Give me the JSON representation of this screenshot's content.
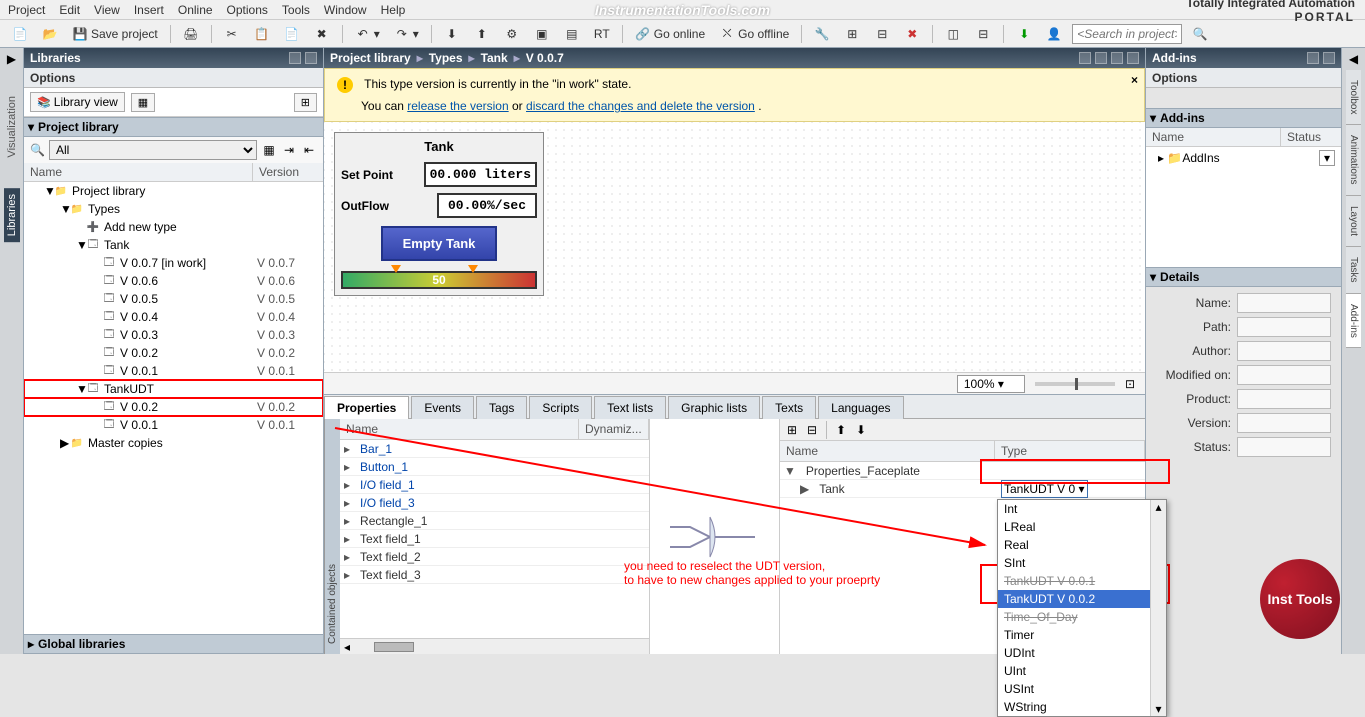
{
  "menubar": [
    "Project",
    "Edit",
    "View",
    "Insert",
    "Online",
    "Options",
    "Tools",
    "Window",
    "Help"
  ],
  "ad_text": "InstrumentationTools.com",
  "portal_title": "Totally Integrated Automation",
  "portal_sub": "PORTAL",
  "toolbar": {
    "save_label": "Save project",
    "go_online": "Go online",
    "go_offline": "Go offline",
    "search_placeholder": "<Search in project>"
  },
  "left": {
    "panel_title": "Libraries",
    "options_label": "Options",
    "library_view_btn": "Library view",
    "section1": "Project library",
    "filter_all": "All",
    "cols": {
      "name": "Name",
      "version": "Version"
    },
    "tree": [
      {
        "indent": 1,
        "caret": "▼",
        "ico": "📁",
        "label": "Project library",
        "ver": ""
      },
      {
        "indent": 2,
        "caret": "▼",
        "ico": "📁",
        "label": "Types",
        "ver": ""
      },
      {
        "indent": 3,
        "caret": "",
        "ico": "➕",
        "label": "Add new type",
        "ver": ""
      },
      {
        "indent": 3,
        "caret": "▼",
        "ico": "🗔",
        "label": "Tank",
        "ver": ""
      },
      {
        "indent": 4,
        "caret": "",
        "ico": "🗔",
        "label": "V 0.0.7 [in work]",
        "ver": "V 0.0.7"
      },
      {
        "indent": 4,
        "caret": "",
        "ico": "🗔",
        "label": "V 0.0.6",
        "ver": "V 0.0.6"
      },
      {
        "indent": 4,
        "caret": "",
        "ico": "🗔",
        "label": "V 0.0.5",
        "ver": "V 0.0.5"
      },
      {
        "indent": 4,
        "caret": "",
        "ico": "🗔",
        "label": "V 0.0.4",
        "ver": "V 0.0.4"
      },
      {
        "indent": 4,
        "caret": "",
        "ico": "🗔",
        "label": "V 0.0.3",
        "ver": "V 0.0.3"
      },
      {
        "indent": 4,
        "caret": "",
        "ico": "🗔",
        "label": "V 0.0.2",
        "ver": "V 0.0.2"
      },
      {
        "indent": 4,
        "caret": "",
        "ico": "🗔",
        "label": "V 0.0.1",
        "ver": "V 0.0.1"
      },
      {
        "indent": 3,
        "caret": "▼",
        "ico": "🗔",
        "label": "TankUDT",
        "ver": "",
        "red": true
      },
      {
        "indent": 4,
        "caret": "",
        "ico": "🗔",
        "label": "V 0.0.2",
        "ver": "V 0.0.2",
        "red": true
      },
      {
        "indent": 4,
        "caret": "",
        "ico": "🗔",
        "label": "V 0.0.1",
        "ver": "V 0.0.1"
      },
      {
        "indent": 2,
        "caret": "▶",
        "ico": "📁",
        "label": "Master copies",
        "ver": ""
      }
    ],
    "section2": "Global libraries"
  },
  "center": {
    "crumbs": [
      "Project library",
      "Types",
      "Tank",
      "V 0.0.7"
    ],
    "notice_text1": "This type version is currently in the \"in work\" state.",
    "notice_text2a": "You can ",
    "notice_link1": "release the version",
    "notice_text2b": " or ",
    "notice_link2": "discard the changes and delete the version",
    "notice_text2c": " .",
    "faceplate": {
      "title": "Tank",
      "setpoint_lbl": "Set Point",
      "setpoint_val": "00.000 liters",
      "outflow_lbl": "OutFlow",
      "outflow_val": "00.00%/sec",
      "empty_btn": "Empty Tank",
      "scale_mid": "50"
    },
    "zoom": "100%"
  },
  "props": {
    "tabs": [
      "Properties",
      "Events",
      "Tags",
      "Scripts",
      "Text lists",
      "Graphic lists",
      "Texts",
      "Languages"
    ],
    "left_cols": {
      "name": "Name",
      "dyn": "Dynamiz..."
    },
    "side_label": "Contained objects",
    "objects": [
      "Bar_1",
      "Button_1",
      "I/O field_1",
      "I/O field_3",
      "Rectangle_1",
      "Text field_1",
      "Text field_2",
      "Text field_3"
    ],
    "right_cols": {
      "name": "Name",
      "type": "Type"
    },
    "right_rows": [
      {
        "caret": "▼",
        "name": "Properties_Faceplate",
        "type": ""
      },
      {
        "caret": "▶",
        "name": "Tank",
        "type": "TankUDT V 0",
        "dd": true
      }
    ],
    "dd_items": [
      "Int",
      "LReal",
      "Real",
      "SInt",
      "TankUDT V 0.0.1",
      "TankUDT V 0.0.2",
      "Time_Of_Day",
      "Timer",
      "UDInt",
      "UInt",
      "USInt",
      "WString"
    ],
    "annotation_l1": "you need to reselect the UDT version,",
    "annotation_l2": "to have to new changes applied to your proeprty"
  },
  "right": {
    "panel_title": "Add-ins",
    "options_label": "Options",
    "section1": "Add-ins",
    "cols": {
      "name": "Name",
      "status": "Status"
    },
    "addins_row": "AddIns",
    "section2": "Details",
    "details": [
      "Name:",
      "Path:",
      "Author:",
      "Modified on:",
      "Product:",
      "Version:",
      "Status:"
    ]
  },
  "side_tabs_left": [
    "Visualization",
    "Libraries"
  ],
  "side_tabs_right": [
    "Toolbox",
    "Animations",
    "Layout",
    "Tasks",
    "Add-ins"
  ],
  "logo": "Inst Tools"
}
